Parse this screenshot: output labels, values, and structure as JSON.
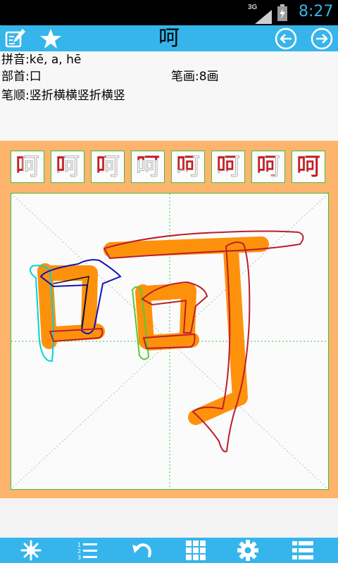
{
  "status_bar": {
    "network": "3G",
    "time": "8:27",
    "time_color": "#33b5e5"
  },
  "header": {
    "character": "呵",
    "left_icons": [
      "edit-icon",
      "star-icon"
    ],
    "right_icons": [
      "arrow-left-icon",
      "arrow-right-icon"
    ],
    "bar_color": "#35b5ec"
  },
  "info": {
    "pinyin_label": "拼音:",
    "pinyin_value": "kē, a, hē",
    "radical_label": "部首:",
    "radical_value": "口",
    "strokes_label": "笔画:",
    "strokes_value": "8画",
    "order_label": "笔顺:",
    "order_value": "竖折横横竖折横竖"
  },
  "practice": {
    "background_color": "#ffb46e",
    "stroke_frames": [
      {
        "character": "呵",
        "strokes_done": 1
      },
      {
        "character": "呵",
        "strokes_done": 2
      },
      {
        "character": "呵",
        "strokes_done": 3
      },
      {
        "character": "呵",
        "strokes_done": 4
      },
      {
        "character": "呵",
        "strokes_done": 5
      },
      {
        "character": "呵",
        "strokes_done": 6
      },
      {
        "character": "呵",
        "strokes_done": 7
      },
      {
        "character": "呵",
        "strokes_done": 8
      }
    ],
    "total_strokes": 8,
    "ink_color": "#d4141a",
    "brush_color": "#ff8c00"
  },
  "bottom_toolbar": {
    "icons": [
      "sparkle-icon",
      "numbered-list-icon",
      "undo-icon",
      "grid-icon",
      "gear-icon",
      "list-icon"
    ]
  }
}
